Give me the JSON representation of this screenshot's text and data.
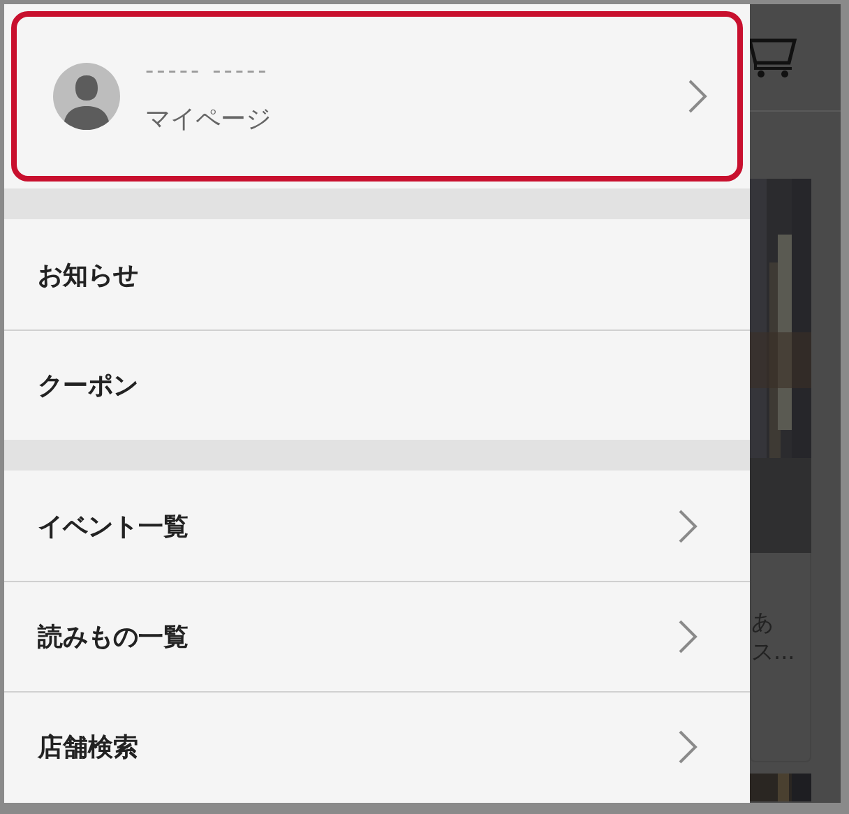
{
  "drawer": {
    "profile": {
      "name": "----- -----",
      "link": "マイページ",
      "highlighted": true
    },
    "groups": [
      [
        {
          "label": "お知らせ",
          "has_arrow": false
        },
        {
          "label": "クーポン",
          "has_arrow": false
        }
      ],
      [
        {
          "label": "イベント一覧",
          "has_arrow": true
        },
        {
          "label": "読みもの一覧",
          "has_arrow": true
        },
        {
          "label": "店舗検索",
          "has_arrow": true
        }
      ]
    ]
  },
  "background_page": {
    "card": {
      "line_1": "あ",
      "line_2": "ス..."
    }
  }
}
